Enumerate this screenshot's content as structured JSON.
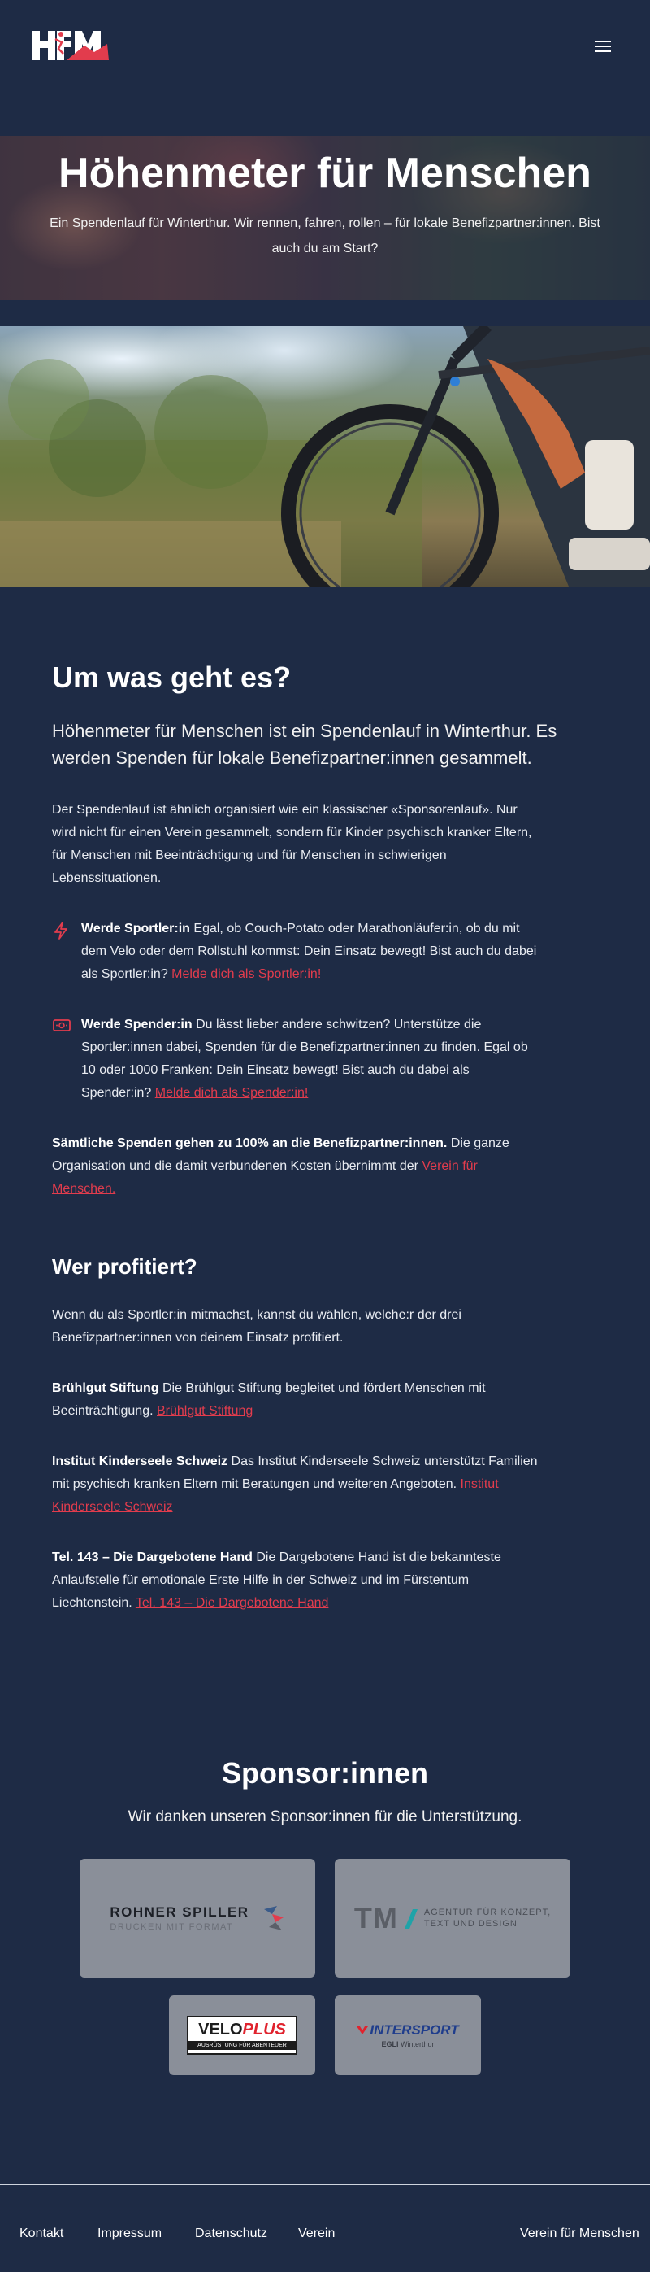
{
  "header": {
    "logo_alt": "HfM",
    "menu_icon": "hamburger-icon"
  },
  "hero": {
    "title": "Höhenmeter für Menschen",
    "subtitle": "Ein Spendenlauf für Winterthur. Wir rennen, fahren, rollen – für lokale Benefizpartner:innen. Bist auch du am Start?"
  },
  "about": {
    "heading": "Um was geht es?",
    "lead": "Höhenmeter für Menschen ist ein Spendenlauf in Winterthur. Es werden Spenden für lokale Benefizpartner:innen gesammelt.",
    "intro": "Der Spendenlauf ist ähnlich organisiert wie ein klassischer «Sponsorenlauf». Nur wird nicht für einen Verein gesammelt, sondern für Kinder psychisch kranker Eltern, für Menschen mit Beeinträchtigung und für Menschen in schwierigen Lebenssituationen.",
    "features": [
      {
        "icon": "lightning-icon",
        "title": "Werde Sportler:in",
        "text": " Egal, ob Couch-Potato oder Marathonläufer:in, ob du mit dem Velo oder dem Rollstuhl kommst: Dein Einsatz bewegt! Bist auch du dabei als Sportler:in? ",
        "link": "Melde dich als Sportler:in!"
      },
      {
        "icon": "money-icon",
        "title": "Werde Spender:in",
        "text": " Du lässt lieber andere schwitzen? Unterstütze die Sportler:innen dabei, Spenden für die Benefizpartner:innen zu finden. Egal ob 10 oder 1000 Franken: Dein Einsatz bewegt! Bist auch du dabei als Spender:in? ",
        "link": "Melde dich als Spender:in!"
      }
    ],
    "donation_bold": "Sämtliche Spenden gehen zu 100% an die Benefizpartner:innen.",
    "donation_text": " Die ganze Organisation und die damit verbundenen Kosten übernimmt der ",
    "donation_link": "Verein für Menschen."
  },
  "beneficiaries": {
    "heading": "Wer profitiert?",
    "intro": "Wenn du als Sportler:in mitmachst, kannst du wählen, welche:r der drei Benefizpartner:innen von deinem Einsatz profitiert.",
    "partners": [
      {
        "name": "Brühlgut Stiftung",
        "text": " Die Brühlgut Stiftung begleitet und fördert Menschen mit Beeinträchtigung. ",
        "link": "Brühlgut Stiftung"
      },
      {
        "name": "Institut Kinderseele Schweiz",
        "text": " Das Institut Kinderseele Schweiz unterstützt Familien mit psychisch kranken Eltern mit Beratungen und weiteren Angeboten. ",
        "link": "Institut Kinderseele Schweiz"
      },
      {
        "name": "Tel. 143 – Die Dargebotene Hand",
        "text": " Die Dargebotene Hand ist die bekannteste Anlaufstelle für emotionale Erste Hilfe in der Schweiz und im Fürstentum Liechtenstein. ",
        "link": "Tel. 143 – Die Dargebotene Hand"
      }
    ]
  },
  "sponsors": {
    "heading": "Sponsor:innen",
    "subtitle": "Wir danken unseren Sponsor:innen für die Unterstützung.",
    "rohner": {
      "line1": "ROHNER SPILLER",
      "line2": "DRUCKEN MIT FORMAT"
    },
    "tm": {
      "mark": "TM",
      "line1": "AGENTUR FÜR KONZEPT,",
      "line2": "TEXT UND DESIGN"
    },
    "veloplus": {
      "velo": "VELO",
      "plus": "PLUS",
      "tagline": "AUSRÜSTUNG FÜR ABENTEUER"
    },
    "intersport": {
      "name": "INTERSPORT",
      "sub1": "EGLI",
      "sub2": "Winterthur"
    }
  },
  "footer": {
    "links": [
      "Kontakt",
      "Impressum",
      "Datenschutz",
      "Verein"
    ],
    "right": "Verein für Menschen"
  }
}
